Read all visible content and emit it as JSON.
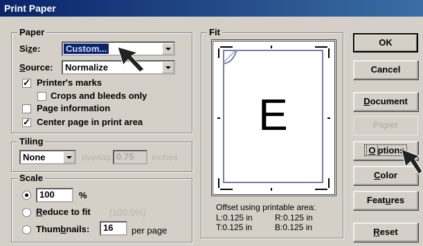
{
  "window": {
    "title": "Print Paper"
  },
  "paper": {
    "group_label": "Paper",
    "size_label": "Size:",
    "size_value": "Custom...",
    "source_label": "Source:",
    "source_value": "Normalize",
    "printers_marks": {
      "label": "Printer's marks",
      "checked": true
    },
    "crops_bleeds": {
      "label": "Crops and bleeds only",
      "checked": false
    },
    "page_info": {
      "label": "Page information",
      "checked": false
    },
    "center_page": {
      "label": "Center page in print area",
      "checked": true
    }
  },
  "tiling": {
    "group_label": "Tiling",
    "mode_value": "None",
    "overlap_label": "overlap",
    "overlap_value": "0.75",
    "units": "inches"
  },
  "scale": {
    "group_label": "Scale",
    "percent_option": {
      "value": "100",
      "unit": "%",
      "selected": true
    },
    "reduce_label": "Reduce to fit",
    "reduce_value": "(100.0%)",
    "thumbnails_label": "Thumbnails:",
    "thumbnails_value": "16",
    "thumbnails_unit": "per page"
  },
  "fit": {
    "group_label": "Fit",
    "page_letter": "E",
    "offset_title": "Offset using printable area:",
    "offset_L": "L:0.125 in",
    "offset_R": "R:0.125 in",
    "offset_T": "T:0.125 in",
    "offset_B": "B:0.125 in"
  },
  "buttons": {
    "ok": "OK",
    "cancel": "Cancel",
    "document": "Document",
    "paper": "Paper",
    "options": "Options",
    "color": "Color",
    "features": "Features",
    "reset": "Reset"
  },
  "colors": {
    "titlebar": "#0a246a",
    "dialog": "#d4d0c8",
    "selection": "#0a246a"
  }
}
